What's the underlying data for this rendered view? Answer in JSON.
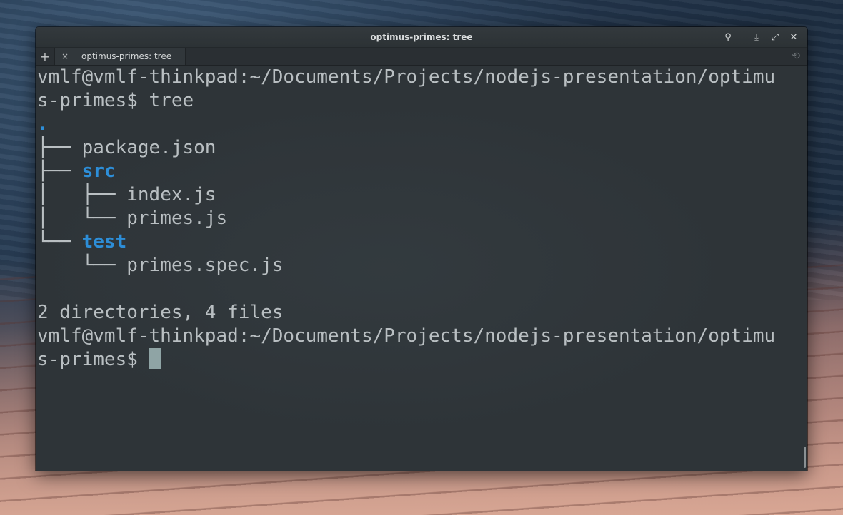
{
  "window": {
    "title": "optimus-primes: tree"
  },
  "titlebar": {
    "icons": [
      "search-icon",
      "download-icon",
      "maximize-icon",
      "close-icon"
    ],
    "glyphs": {
      "search": "⚲",
      "download": "⤓",
      "maximize": "⤢",
      "close": "✕"
    }
  },
  "tabbar": {
    "add_glyph": "+",
    "tabs": [
      {
        "label": "optimus-primes: tree",
        "close_glyph": "×"
      }
    ],
    "history_glyph": "⟲"
  },
  "terminal": {
    "prompt_line1": "vmlf@vmlf-thinkpad:~/Documents/Projects/nodejs-presentation/optimu",
    "prompt_line2_prefix": "s-primes$ ",
    "command": "tree",
    "tree": {
      "root": ".",
      "entries": [
        {
          "prefix": "├── ",
          "name": "package.json",
          "is_dir": false
        },
        {
          "prefix": "├── ",
          "name": "src",
          "is_dir": true
        },
        {
          "prefix": "│   ├── ",
          "name": "index.js",
          "is_dir": false
        },
        {
          "prefix": "│   └── ",
          "name": "primes.js",
          "is_dir": false
        },
        {
          "prefix": "└── ",
          "name": "test",
          "is_dir": true
        },
        {
          "prefix": "    └── ",
          "name": "primes.spec.js",
          "is_dir": false
        }
      ]
    },
    "summary": "2 directories, 4 files",
    "prompt2_line1": "vmlf@vmlf-thinkpad:~/Documents/Projects/nodejs-presentation/optimu",
    "prompt2_line2": "s-primes$ "
  },
  "colors": {
    "directory": "#2d8ed8",
    "text": "#b9bfc2",
    "background": "#2e3438",
    "cursor": "#8fa4a5"
  }
}
